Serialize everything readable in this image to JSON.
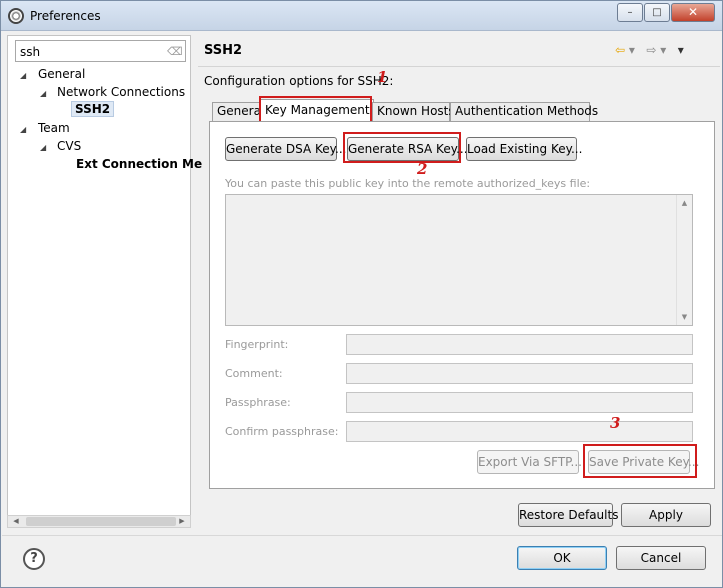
{
  "window": {
    "title": "Preferences"
  },
  "window_controls": {
    "minimize": "–",
    "maximize": "□",
    "close": "✕"
  },
  "filter": {
    "value": "ssh",
    "clear_icon": "⌫"
  },
  "tree": [
    {
      "label": "General",
      "level": 0
    },
    {
      "label": "Network Connections",
      "level": 1
    },
    {
      "label": "SSH2",
      "level": 2,
      "selected": true
    },
    {
      "label": "Team",
      "level": 0
    },
    {
      "label": "CVS",
      "level": 1
    },
    {
      "label": "Ext Connection Me",
      "level": 2
    }
  ],
  "page": {
    "title": "SSH2",
    "description": "Configuration options for SSH2:",
    "nav": {
      "back": "⇦",
      "back_menu": "▾",
      "forward": "⇨",
      "forward_menu": "▾",
      "view_menu": "▾"
    }
  },
  "tabs": [
    {
      "label": "General",
      "active": false
    },
    {
      "label": "Key Management",
      "active": true
    },
    {
      "label": "Known Hosts",
      "active": false
    },
    {
      "label": "Authentication Methods",
      "active": false
    }
  ],
  "key_management": {
    "generate_dsa": "Generate DSA Key...",
    "generate_rsa": "Generate RSA Key...",
    "load_existing": "Load Existing Key...",
    "hint": "You can paste this public key into the remote authorized_keys file:",
    "fields": [
      {
        "label": "Fingerprint:",
        "value": ""
      },
      {
        "label": "Comment:",
        "value": ""
      },
      {
        "label": "Passphrase:",
        "value": ""
      },
      {
        "label": "Confirm passphrase:",
        "value": ""
      }
    ],
    "export_sftp": "Export Via SFTP...",
    "save_private_key": "Save Private Key..."
  },
  "buttons": {
    "restore_defaults": "Restore Defaults",
    "apply": "Apply",
    "ok": "OK",
    "cancel": "Cancel"
  },
  "help": {
    "icon": "?"
  },
  "annotations": [
    "1",
    "2",
    "3"
  ],
  "colors": {
    "annotation": "#d01c1c",
    "selection": "#dfe9f5"
  }
}
